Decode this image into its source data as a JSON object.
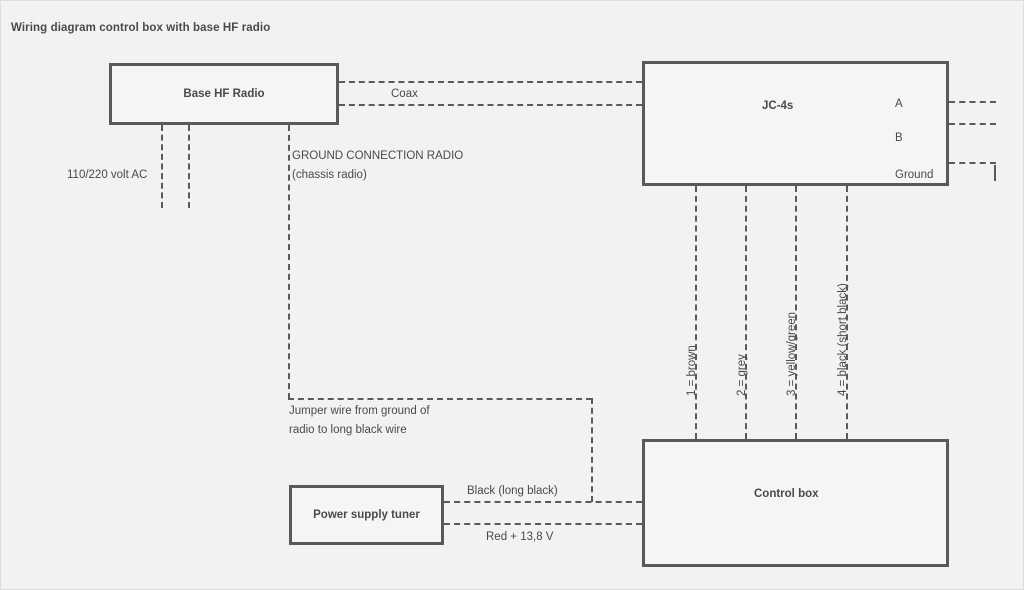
{
  "diagram": {
    "title": "Wiring diagram control box with base HF radio",
    "accent_color": "#595959",
    "background_color": "#f2f2f2",
    "box_fill_color": "#f5f5f5",
    "text_color": "#4a4a4a"
  },
  "boxes": {
    "base_radio": {
      "label": "Base HF Radio"
    },
    "jc4s": {
      "label": "JC-4s",
      "pins": [
        {
          "label": "A"
        },
        {
          "label": "B"
        },
        {
          "label": "Ground"
        }
      ]
    },
    "power_supply": {
      "label": "Power supply tuner"
    },
    "control_box": {
      "label": "Control box"
    }
  },
  "labels": {
    "coax": "Coax",
    "mains": "110/220 volt AC",
    "ground_connection_line1": "GROUND CONNECTION RADIO",
    "ground_connection_line2": "(chassis radio)",
    "jumper_line1": "Jumper wire from ground of",
    "jumper_line2": "radio to long black wire",
    "black_long": "Black (long black)",
    "red_voltage": "Red + 13,8 V"
  },
  "wire_labels": [
    {
      "text": "1 = brown"
    },
    {
      "text": "2 = grey"
    },
    {
      "text": "3 = yellow/green"
    },
    {
      "text": "4 = black (short black)"
    }
  ]
}
